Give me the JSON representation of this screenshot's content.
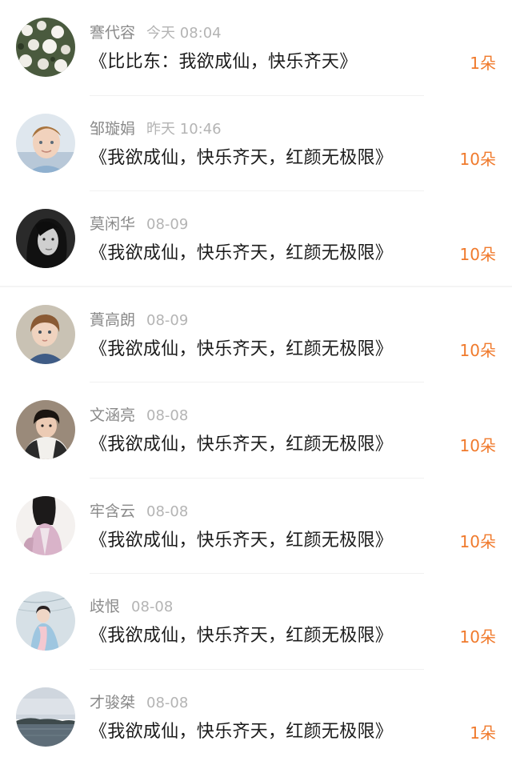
{
  "gift_list": {
    "items": [
      {
        "name": "謇代容",
        "time": "今天 08:04",
        "title": "《比比东：我欲成仙，快乐齐天》",
        "gift": "1朵",
        "avatar": "flowers-avatar"
      },
      {
        "name": "邹璇娟",
        "time": "昨天 10:46",
        "title": "《我欲成仙，快乐齐天，红颜无极限》",
        "gift": "10朵",
        "avatar": "boy-avatar"
      },
      {
        "name": "莫闲华",
        "time": "08-09",
        "title": "《我欲成仙，快乐齐天，红颜无极限》",
        "gift": "10朵",
        "avatar": "woman-bw-avatar"
      },
      {
        "name": "蕢高朗",
        "time": "08-09",
        "title": "《我欲成仙，快乐齐天，红颜无极限》",
        "gift": "10朵",
        "avatar": "child-avatar"
      },
      {
        "name": "文涵亮",
        "time": "08-08",
        "title": "《我欲成仙，快乐齐天，红颜无极限》",
        "gift": "10朵",
        "avatar": "young-man-avatar"
      },
      {
        "name": "牢含云",
        "time": "08-08",
        "title": "《我欲成仙，快乐齐天，红颜无极限》",
        "gift": "10朵",
        "avatar": "girl-pink-avatar"
      },
      {
        "name": "歧恨",
        "time": "08-08",
        "title": "《我欲成仙，快乐齐天，红颜无极限》",
        "gift": "10朵",
        "avatar": "hanfu-girl-avatar"
      },
      {
        "name": "才骏桀",
        "time": "08-08",
        "title": "《我欲成仙，快乐齐天，红颜无极限》",
        "gift": "1朵",
        "avatar": "lake-landscape-avatar"
      }
    ]
  },
  "colors": {
    "name": "#8a8a8a",
    "time": "#b4b4b4",
    "title": "#1c1c1c",
    "gift": "#f07a2c"
  }
}
